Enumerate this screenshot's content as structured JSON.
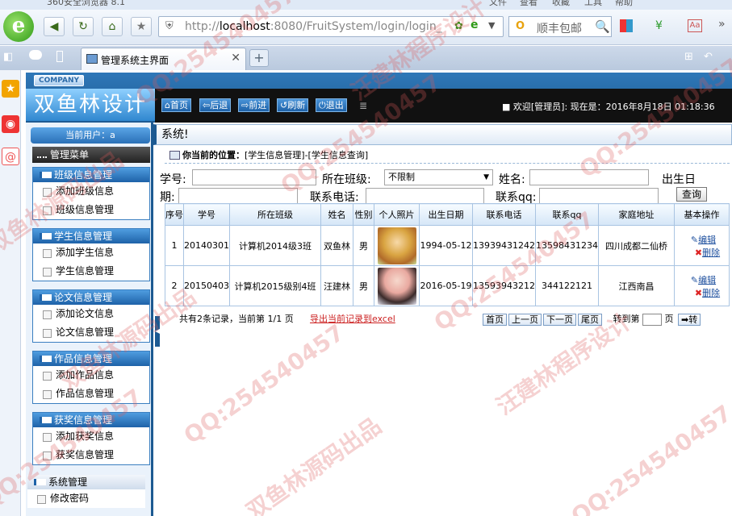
{
  "browser": {
    "title": "360安全浏览器 8.1",
    "menu": [
      "文件",
      "查看",
      "收藏",
      "工具",
      "帮助"
    ],
    "url_host": "localhost",
    "url_rest": ":8080/FruitSystem/login/login_",
    "url_prefix": "http://",
    "search_placeholder": "顺丰包邮",
    "tab_title": "管理系统主界面",
    "logo_glyph": "e"
  },
  "header": {
    "company": "COMPANY",
    "brand": "双鱼林设计",
    "nav": [
      "首页",
      "后退",
      "前进",
      "刷新",
      "退出"
    ],
    "welcome": "欢迎[管理员]:    现在是：2016年8月18日 01:18:36"
  },
  "sidebar": {
    "current_user": "当前用户：a",
    "menu_title": "管理菜单",
    "groups": [
      {
        "title": "班级信息管理",
        "items": [
          "添加班级信息",
          "班级信息管理"
        ]
      },
      {
        "title": "学生信息管理",
        "items": [
          "添加学生信息",
          "学生信息管理"
        ]
      },
      {
        "title": "论文信息管理",
        "items": [
          "添加论文信息",
          "论文信息管理"
        ]
      },
      {
        "title": "作品信息管理",
        "items": [
          "添加作品信息",
          "作品信息管理"
        ]
      },
      {
        "title": "获奖信息管理",
        "items": [
          "添加获奖信息",
          "获奖信息管理"
        ]
      },
      {
        "title": "系统管理",
        "items": [
          "修改密码"
        ]
      }
    ]
  },
  "main": {
    "sys_title": "系统!",
    "location_label": "你当前的位置：",
    "location_path": "[学生信息管理]-[学生信息查询]",
    "search": {
      "student_no_label": "学号:",
      "class_label": "所在班级:",
      "class_value": "不限制",
      "name_label": "姓名:",
      "birth_label_1": "出生日",
      "birth_label_2": "期:",
      "phone_label": "联系电话:",
      "qq_label": "联系qq:",
      "query_button": "查询"
    },
    "table": {
      "headers": [
        "序号",
        "学号",
        "所在班级",
        "姓名",
        "性别",
        "个人照片",
        "出生日期",
        "联系电话",
        "联系qq",
        "家庭地址",
        "基本操作"
      ],
      "rows": [
        {
          "seq": "1",
          "no": "20140301",
          "class": "计算机2014级3班",
          "name": "双鱼林",
          "sex": "男",
          "birth": "1994-05-12",
          "phone": "13939431242",
          "qq": "13598431234",
          "addr": "四川成都二仙桥"
        },
        {
          "seq": "2",
          "no": "20150403",
          "class": "计算机2015级别4班",
          "name": "汪建林",
          "sex": "男",
          "birth": "2016-05-19",
          "phone": "13593943212",
          "qq": "344122121",
          "addr": "江西南昌"
        }
      ],
      "edit_label": "编辑",
      "delete_label": "删除"
    },
    "footer": {
      "summary": "共有2条记录，当前第 1/1 页",
      "export": "导出当前记录到excel",
      "pager": [
        "首页",
        "上一页",
        "下一页",
        "尾页"
      ],
      "goto_label": "转到第",
      "page_unit": "页",
      "go_button": "转"
    }
  },
  "watermarks": [
    "QQ:254540457",
    "双鱼林源码出品",
    "汪建林程序设计"
  ]
}
